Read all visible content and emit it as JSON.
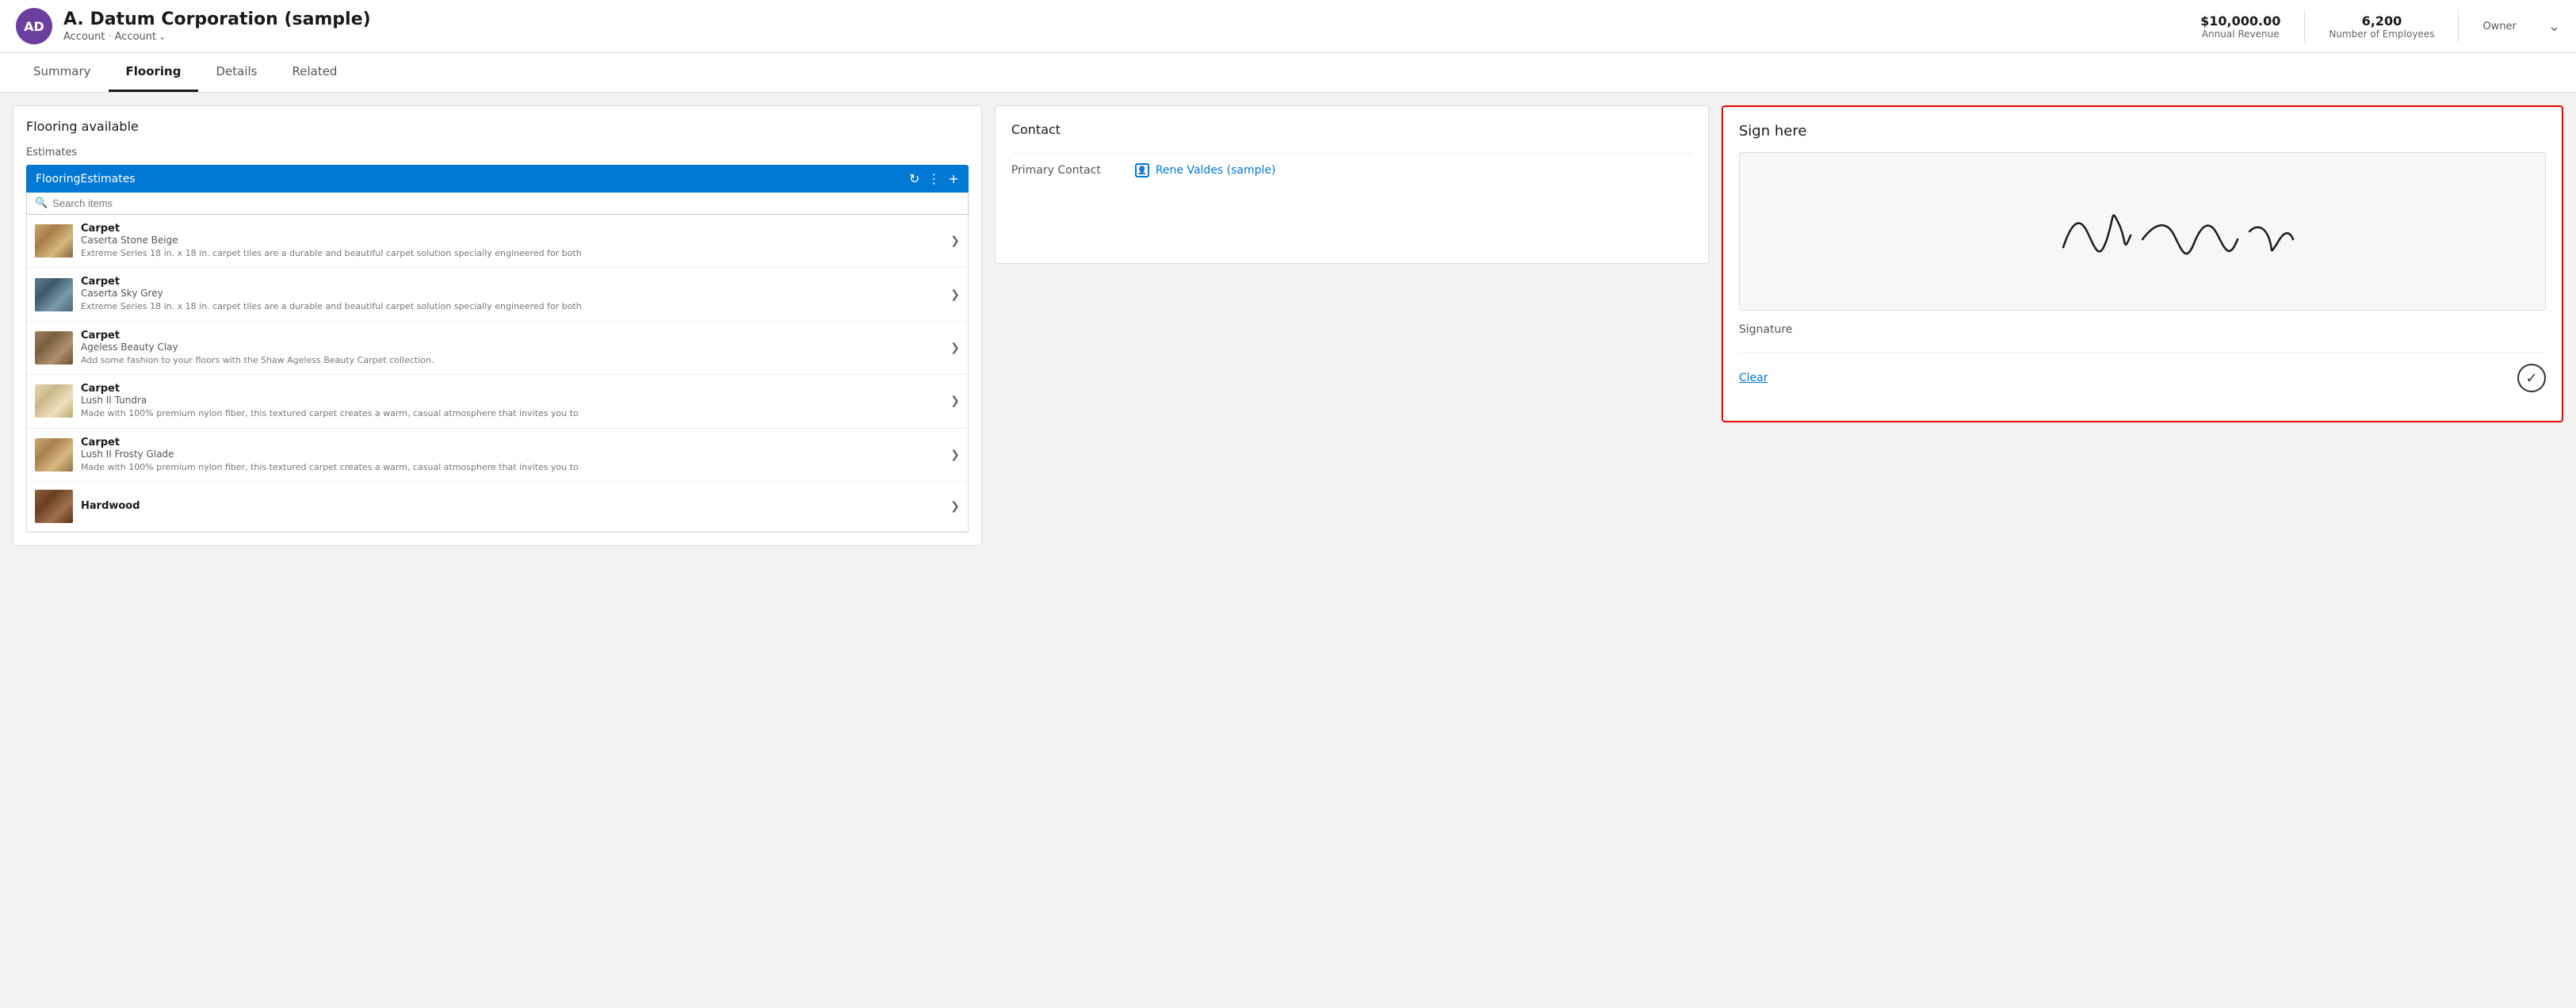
{
  "header": {
    "avatar_initials": "AD",
    "title": "A. Datum Corporation (sample)",
    "breadcrumb1": "Account",
    "separator": "·",
    "breadcrumb2": "Account",
    "annual_revenue_value": "$10,000.00",
    "annual_revenue_label": "Annual Revenue",
    "employees_value": "6,200",
    "employees_label": "Number of Employees",
    "owner_label": "Owner"
  },
  "tabs": {
    "items": [
      {
        "id": "summary",
        "label": "Summary",
        "active": false
      },
      {
        "id": "flooring",
        "label": "Flooring",
        "active": true
      },
      {
        "id": "details",
        "label": "Details",
        "active": false
      },
      {
        "id": "related",
        "label": "Related",
        "active": false
      }
    ]
  },
  "flooring_panel": {
    "title": "Flooring available",
    "estimates_label": "Estimates",
    "subview_label": "FlooringEstimates",
    "search_placeholder": "Search items",
    "items": [
      {
        "id": "carpet-beige",
        "category": "Carpet",
        "name": "Caserta Stone Beige",
        "desc": "Extreme Series 18 in. x 18 in. carpet tiles are a durable and beautiful carpet solution specially engineered for both",
        "swatch": "beige"
      },
      {
        "id": "carpet-grey",
        "category": "Carpet",
        "name": "Caserta Sky Grey",
        "desc": "Extreme Series 18 in. x 18 in. carpet tiles are a durable and beautiful carpet solution specially engineered for both",
        "swatch": "grey"
      },
      {
        "id": "carpet-clay",
        "category": "Carpet",
        "name": "Ageless Beauty Clay",
        "desc": "Add some fashion to your floors with the Shaw Ageless Beauty Carpet collection.",
        "swatch": "clay"
      },
      {
        "id": "carpet-tundra",
        "category": "Carpet",
        "name": "Lush II Tundra",
        "desc": "Made with 100% premium nylon fiber, this textured carpet creates a warm, casual atmosphere that invites you to",
        "swatch": "tundra"
      },
      {
        "id": "carpet-glade",
        "category": "Carpet",
        "name": "Lush II Frosty Glade",
        "desc": "Made with 100% premium nylon fiber, this textured carpet creates a warm, casual atmosphere that invites you to",
        "swatch": "glade"
      },
      {
        "id": "hardwood",
        "category": "Hardwood",
        "name": "",
        "desc": "",
        "swatch": "hardwood"
      }
    ]
  },
  "contact_panel": {
    "title": "Contact",
    "primary_contact_label": "Primary Contact",
    "primary_contact_value": "Rene Valdes (sample)"
  },
  "sign_panel": {
    "title": "Sign here",
    "signature_label": "Signature",
    "clear_label": "Clear"
  }
}
